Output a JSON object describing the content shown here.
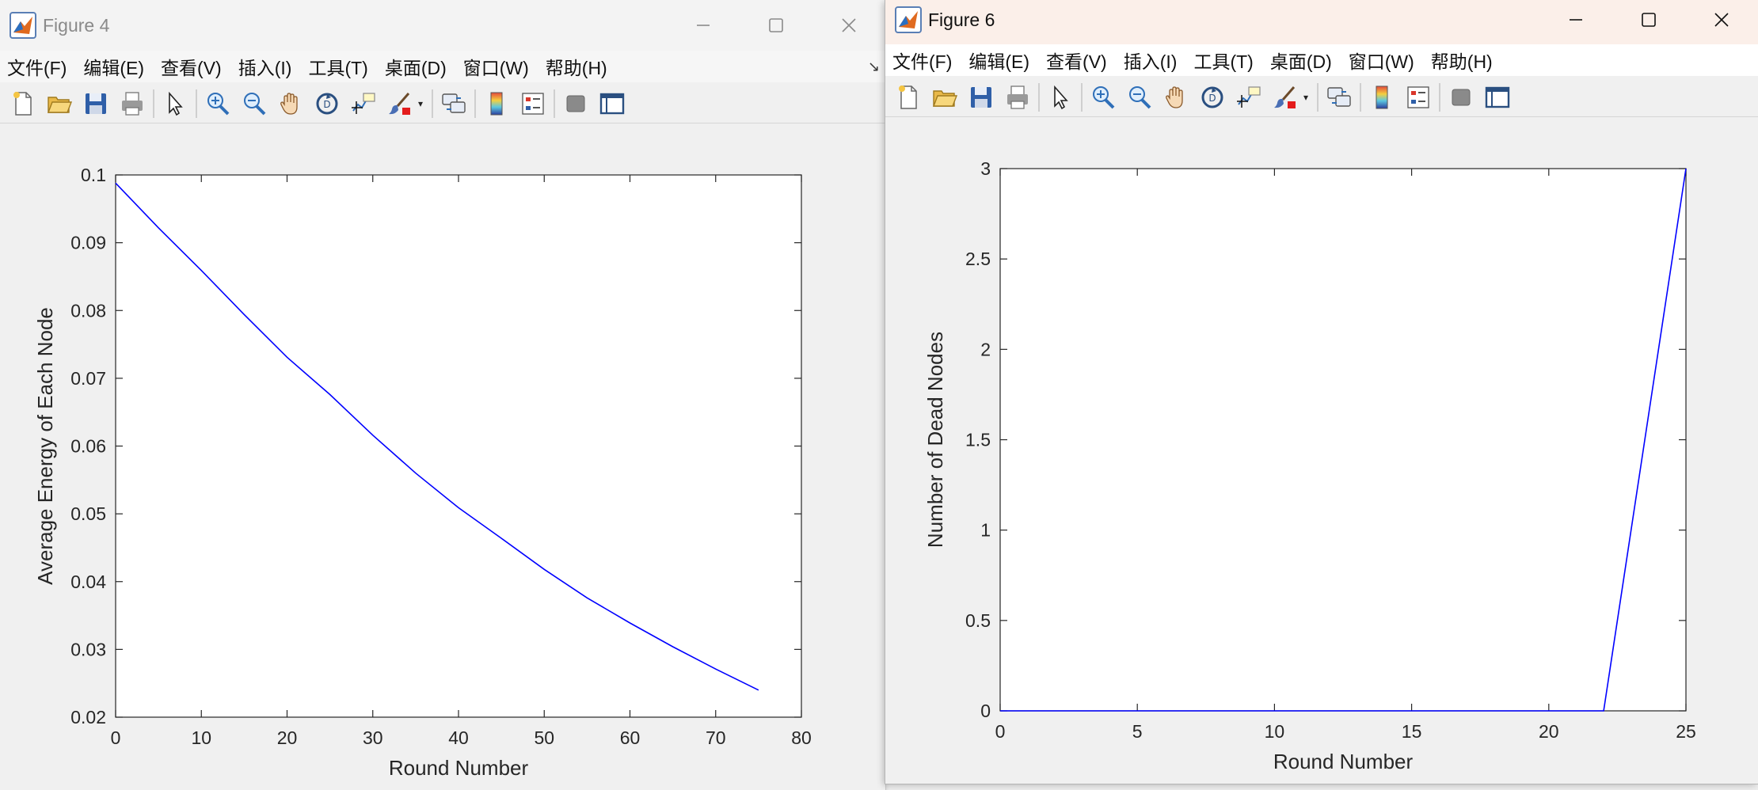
{
  "windows": [
    {
      "title": "Figure 4",
      "menus": [
        "文件(F)",
        "编辑(E)",
        "查看(V)",
        "插入(I)",
        "工具(T)",
        "桌面(D)",
        "窗口(W)",
        "帮助(H)"
      ]
    },
    {
      "title": "Figure 6",
      "menus": [
        "文件(F)",
        "编辑(E)",
        "查看(V)",
        "插入(I)",
        "工具(T)",
        "桌面(D)",
        "窗口(W)",
        "帮助(H)"
      ]
    }
  ],
  "toolbar_icons": [
    "new-figure-icon",
    "open-file-icon",
    "save-icon",
    "print-icon",
    "select-arrow-icon",
    "zoom-in-icon",
    "zoom-out-icon",
    "pan-hand-icon",
    "rotate-3d-icon",
    "data-cursor-icon",
    "brush-icon",
    "link-plot-icon",
    "colorbar-icon",
    "legend-icon",
    "hide-plot-tools-icon",
    "show-plot-tools-icon"
  ],
  "colors": {
    "line": "#0000ff",
    "axes": "#262626",
    "plot_bg": "#ffffff",
    "figure_bg": "#f0f0f0"
  },
  "chart_data": [
    {
      "type": "line",
      "xlabel": "Round Number",
      "ylabel": "Average Energy of Each Node",
      "xlim": [
        0,
        80
      ],
      "ylim": [
        0.02,
        0.1
      ],
      "xticks": [
        0,
        10,
        20,
        30,
        40,
        50,
        60,
        70,
        80
      ],
      "yticks": [
        0.02,
        0.03,
        0.04,
        0.05,
        0.06,
        0.07,
        0.08,
        0.09,
        0.1
      ],
      "xtick_labels": [
        "0",
        "10",
        "20",
        "30",
        "40",
        "50",
        "60",
        "70",
        "80"
      ],
      "ytick_labels": [
        "0.02",
        "0.03",
        "0.04",
        "0.05",
        "0.06",
        "0.07",
        "0.08",
        "0.09",
        "0.1"
      ],
      "grid": false,
      "series": [
        {
          "x": [
            0,
            5,
            10,
            15,
            20,
            25,
            30,
            35,
            40,
            45,
            50,
            55,
            60,
            65,
            70,
            75
          ],
          "y": [
            0.0988,
            0.0922,
            0.0859,
            0.0794,
            0.0731,
            0.0676,
            0.0616,
            0.056,
            0.0509,
            0.0464,
            0.0418,
            0.0376,
            0.0339,
            0.0304,
            0.0271,
            0.024
          ]
        }
      ]
    },
    {
      "type": "line",
      "xlabel": "Round Number",
      "ylabel": "Number of Dead Nodes",
      "xlim": [
        0,
        25
      ],
      "ylim": [
        0,
        3
      ],
      "xticks": [
        0,
        5,
        10,
        15,
        20,
        25
      ],
      "yticks": [
        0,
        0.5,
        1,
        1.5,
        2,
        2.5,
        3
      ],
      "xtick_labels": [
        "0",
        "5",
        "10",
        "15",
        "20",
        "25"
      ],
      "ytick_labels": [
        "0",
        "0.5",
        "1",
        "1.5",
        "2",
        "2.5",
        "3"
      ],
      "grid": false,
      "series": [
        {
          "x": [
            0,
            22,
            25
          ],
          "y": [
            0,
            0,
            3
          ]
        }
      ]
    }
  ]
}
